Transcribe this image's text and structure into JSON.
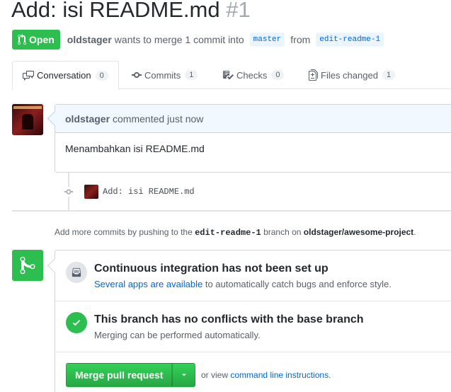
{
  "header": {
    "title": "Add: isi README.md",
    "number": "#1"
  },
  "meta": {
    "state": "Open",
    "author": "oldstager",
    "action": "wants to merge 1 commit into",
    "base_branch": "master",
    "from_word": "from",
    "head_branch": "edit-readme-1"
  },
  "tabs": [
    {
      "label": "Conversation",
      "count": "0",
      "icon": "comment-discussion-icon"
    },
    {
      "label": "Commits",
      "count": "1",
      "icon": "git-commit-icon"
    },
    {
      "label": "Checks",
      "count": "0",
      "icon": "checklist-icon"
    },
    {
      "label": "Files changed",
      "count": "1",
      "icon": "file-diff-icon"
    }
  ],
  "comment": {
    "author": "oldstager",
    "action": "commented just now",
    "body": "Menambahkan isi README.md"
  },
  "commit": {
    "message": "Add: isi README.md"
  },
  "hint": {
    "prefix": "Add more commits by pushing to the",
    "branch": "edit-readme-1",
    "middle": "branch on",
    "repo": "oldstager/awesome-project",
    "suffix": "."
  },
  "merge": {
    "ci_title": "Continuous integration has not been set up",
    "ci_link": "Several apps are available",
    "ci_rest": "to automatically catch bugs and enforce style.",
    "conflict_title": "This branch has no conflicts with the base branch",
    "conflict_sub": "Merging can be performed automatically.",
    "button_label": "Merge pull request",
    "alt_prefix": "or view",
    "alt_link": "command line instructions",
    "alt_suffix": "."
  },
  "colors": {
    "green": "#2cbe4e",
    "link": "#0366d6",
    "header_bg": "#f1f8ff"
  }
}
